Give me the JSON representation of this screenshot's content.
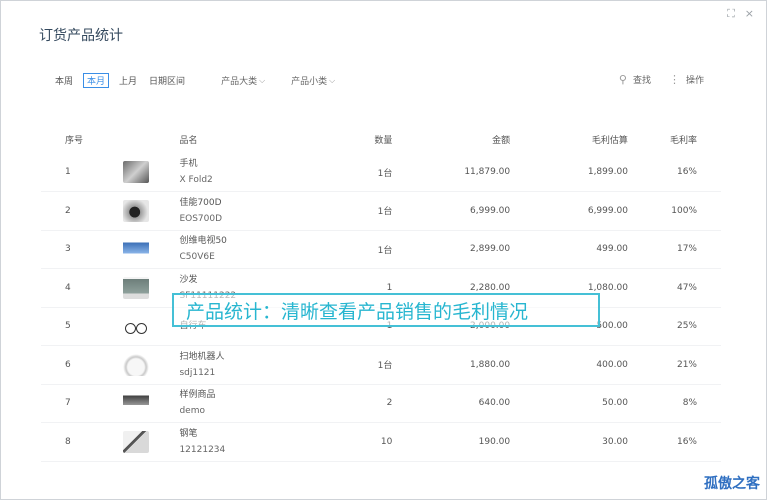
{
  "window_controls": {
    "maximize": "⛶",
    "close": "×"
  },
  "modal": {
    "title": "订货产品统计"
  },
  "filters": {
    "periods": [
      {
        "label": "本周"
      },
      {
        "label": "本月",
        "active": true
      },
      {
        "label": "上月"
      },
      {
        "label": "日期区间"
      }
    ],
    "category": "产品大类",
    "subcategory": "产品小类"
  },
  "tools": {
    "search": "查找",
    "actions": "操作"
  },
  "table": {
    "headers": {
      "idx": "序号",
      "name": "品名",
      "qty": "数量",
      "amount": "金额",
      "gross_profit": "毛利估算",
      "rate": "毛利率"
    },
    "rows": [
      {
        "idx": "1",
        "image_icon": "phone-image",
        "name": "手机",
        "code": "X Fold2",
        "qty": "1台",
        "amount": "11,879.00",
        "gross_profit": "1,899.00",
        "rate": "16%"
      },
      {
        "idx": "2",
        "image_icon": "camera-image",
        "name": "佳能700D",
        "code": "EOS700D",
        "qty": "1台",
        "amount": "6,999.00",
        "gross_profit": "6,999.00",
        "rate": "100%"
      },
      {
        "idx": "3",
        "image_icon": "tv-image",
        "name": "创维电视50",
        "code": "C50V6E",
        "qty": "1台",
        "amount": "2,899.00",
        "gross_profit": "499.00",
        "rate": "17%"
      },
      {
        "idx": "4",
        "image_icon": "sofa-image",
        "name": "沙发",
        "code": "SF11111222",
        "qty": "1",
        "amount": "2,280.00",
        "gross_profit": "1,080.00",
        "rate": "47%"
      },
      {
        "idx": "5",
        "image_icon": "bicycle-image",
        "name": "自行车",
        "code": "",
        "qty": "1",
        "amount": "2,000.00",
        "gross_profit": "500.00",
        "rate": "25%"
      },
      {
        "idx": "6",
        "image_icon": "robot-vacuum-image",
        "name": "扫地机器人",
        "code": "sdj1121",
        "qty": "1台",
        "amount": "1,880.00",
        "gross_profit": "400.00",
        "rate": "21%"
      },
      {
        "idx": "7",
        "image_icon": "sample-product-image",
        "name": "样例商品",
        "code": "demo",
        "qty": "2",
        "amount": "640.00",
        "gross_profit": "50.00",
        "rate": "8%"
      },
      {
        "idx": "8",
        "image_icon": "pen-image",
        "name": "钢笔",
        "code": "12121234",
        "qty": "10",
        "amount": "190.00",
        "gross_profit": "30.00",
        "rate": "16%"
      }
    ]
  },
  "overlay_caption": "产品统计：清晰查看产品销售的毛利情况",
  "watermark": "孤傲之客"
}
